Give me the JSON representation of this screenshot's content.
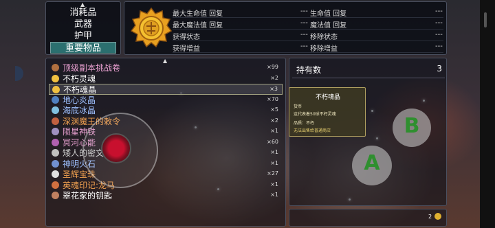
{
  "categories": {
    "items": [
      "消耗品",
      "武器",
      "护甲",
      "重要物品"
    ],
    "active_index": 3
  },
  "detail": {
    "rows": [
      {
        "left_label": "最大生命值 回复",
        "left_value": "---",
        "right_label": "生命值 回复",
        "right_value": "---"
      },
      {
        "left_label": "最大魔法值 回复",
        "left_value": "---",
        "right_label": "魔法值 回复",
        "right_value": "---"
      },
      {
        "left_label": "获得状态",
        "left_value": "---",
        "right_label": "移除状态",
        "right_value": "---"
      },
      {
        "left_label": "获得增益",
        "left_value": "---",
        "right_label": "移除增益",
        "right_value": "---"
      }
    ]
  },
  "items": [
    {
      "name": "顶级副本挑战卷",
      "qty": "×99",
      "color": "#e8a0d0",
      "icon": "scroll-icon"
    },
    {
      "name": "不朽灵魂",
      "qty": "×2",
      "color": "#ffffff",
      "icon": "soul-icon"
    },
    {
      "name": "不朽魂晶",
      "qty": "×3",
      "color": "#ffffff",
      "icon": "crystal-icon"
    },
    {
      "name": "地心炎晶",
      "qty": "×70",
      "color": "#9ec0ff",
      "icon": "flame-icon"
    },
    {
      "name": "海底冰晶",
      "qty": "×5",
      "color": "#9ec0ff",
      "icon": "ice-icon"
    },
    {
      "name": "深渊魔王的敕令",
      "qty": "×2",
      "color": "#f0a050",
      "icon": "decree-icon"
    },
    {
      "name": "陨星神铁",
      "qty": "×1",
      "color": "#e8a0d0",
      "icon": "ore-icon"
    },
    {
      "name": "冥河心能",
      "qty": "×60",
      "color": "#e8a0d0",
      "icon": "heart-icon"
    },
    {
      "name": "矮人的密文",
      "qty": "×1",
      "color": "#cccccc",
      "icon": "tablet-icon"
    },
    {
      "name": "神明火石",
      "qty": "×1",
      "color": "#9ec0ff",
      "icon": "firestone-icon"
    },
    {
      "name": "圣辉宝珠",
      "qty": "×27",
      "color": "#f0a050",
      "icon": "orb-icon"
    },
    {
      "name": "英魂印记:龙马",
      "qty": "×1",
      "color": "#f0a050",
      "icon": "mark-icon"
    },
    {
      "name": "翠花家的钥匙",
      "qty": "×1",
      "color": "#ffffff",
      "icon": "key-icon"
    }
  ],
  "selected_index": 2,
  "owned": {
    "title": "持有数",
    "count": "3"
  },
  "tooltip": {
    "title": "不朽魂晶",
    "lines": [
      "货币",
      "这代表着50球不朽灵魂",
      "品质：不朽",
      "无法出售给普通商店"
    ]
  },
  "currency": {
    "value": "2"
  },
  "buttons": {
    "a": "A",
    "b": "B"
  },
  "colors": {
    "accent": "#2b6f6f",
    "panel_border": "#4a5060",
    "button_letter": "#2f8f2f"
  }
}
